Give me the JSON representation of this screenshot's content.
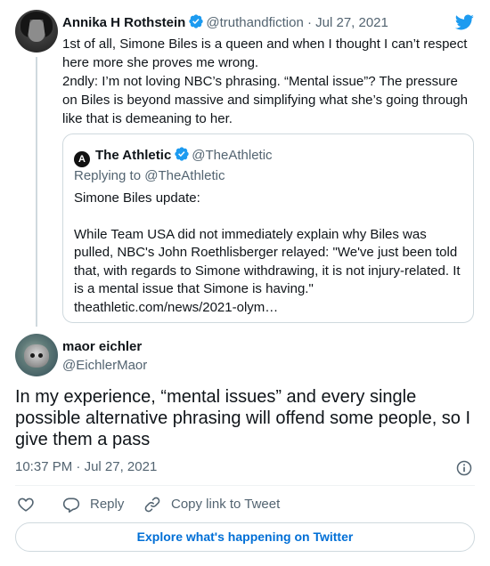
{
  "parent": {
    "name": "Annika H Rothstein",
    "handle": "@truthandfiction",
    "separator": "·",
    "date": "Jul 27, 2021",
    "lines": [
      "1st of all, Simone Biles is a queen and when I thought I can’t respect here more she proves me wrong.",
      "2ndly: I’m not loving NBC’s phrasing. “Mental issue”? The pressure on Biles is beyond massive and simplifying what she’s going through like that is demeaning to her."
    ]
  },
  "quote": {
    "logo_letter": "A",
    "name": "The Athletic",
    "handle": "@TheAthletic",
    "replying": "Replying to @TheAthletic",
    "line1": "Simone Biles update:",
    "line2": "While Team USA did not immediately explain why Biles was pulled, NBC's John Roethlisberger relayed: \"We've just been told that, with regards to Simone withdrawing, it is not injury-related. It is a mental issue that Simone is having.\"",
    "link": "theathletic.com/news/2021-olym…"
  },
  "tweet": {
    "name": "maor eichler",
    "handle": "@EichlerMaor",
    "text": "In my experience, “mental issues” and every single possible alternative phrasing will offend some people, so I give them a pass",
    "time": "10:37 PM",
    "separator": "·",
    "date": "Jul 27, 2021"
  },
  "actions": {
    "like_icon": "heart-icon",
    "reply_label": "Reply",
    "copy_label": "Copy link to Tweet"
  },
  "explore_label": "Explore what's happening on Twitter",
  "colors": {
    "accent": "#1d9bf0",
    "link": "#006fd6",
    "muted": "#536471",
    "border": "#cfd9de"
  }
}
